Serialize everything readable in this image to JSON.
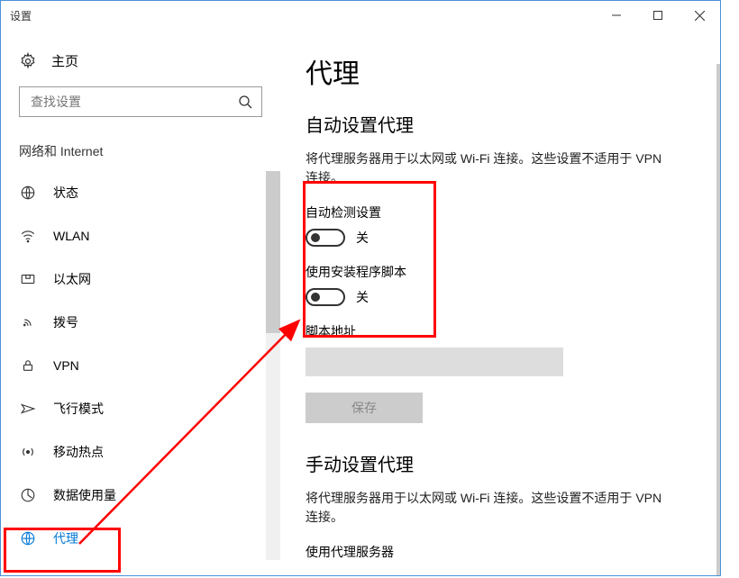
{
  "window": {
    "title": "设置"
  },
  "home_label": "主页",
  "search": {
    "placeholder": "查找设置"
  },
  "sidebar": {
    "section_title": "网络和 Internet",
    "items": [
      {
        "label": "状态"
      },
      {
        "label": "WLAN"
      },
      {
        "label": "以太网"
      },
      {
        "label": "拨号"
      },
      {
        "label": "VPN"
      },
      {
        "label": "飞行模式"
      },
      {
        "label": "移动热点"
      },
      {
        "label": "数据使用量"
      },
      {
        "label": "代理"
      }
    ]
  },
  "page": {
    "title": "代理",
    "auto": {
      "heading": "自动设置代理",
      "desc": "将代理服务器用于以太网或 Wi-Fi 连接。这些设置不适用于 VPN 连接。",
      "detect_label": "自动检测设置",
      "detect_state": "关",
      "script_label": "使用安装程序脚本",
      "script_state": "关",
      "script_addr_label": "脚本地址",
      "save_label": "保存"
    },
    "manual": {
      "heading": "手动设置代理",
      "desc": "将代理服务器用于以太网或 Wi-Fi 连接。这些设置不适用于 VPN 连接。",
      "use_proxy_label": "使用代理服务器"
    }
  }
}
